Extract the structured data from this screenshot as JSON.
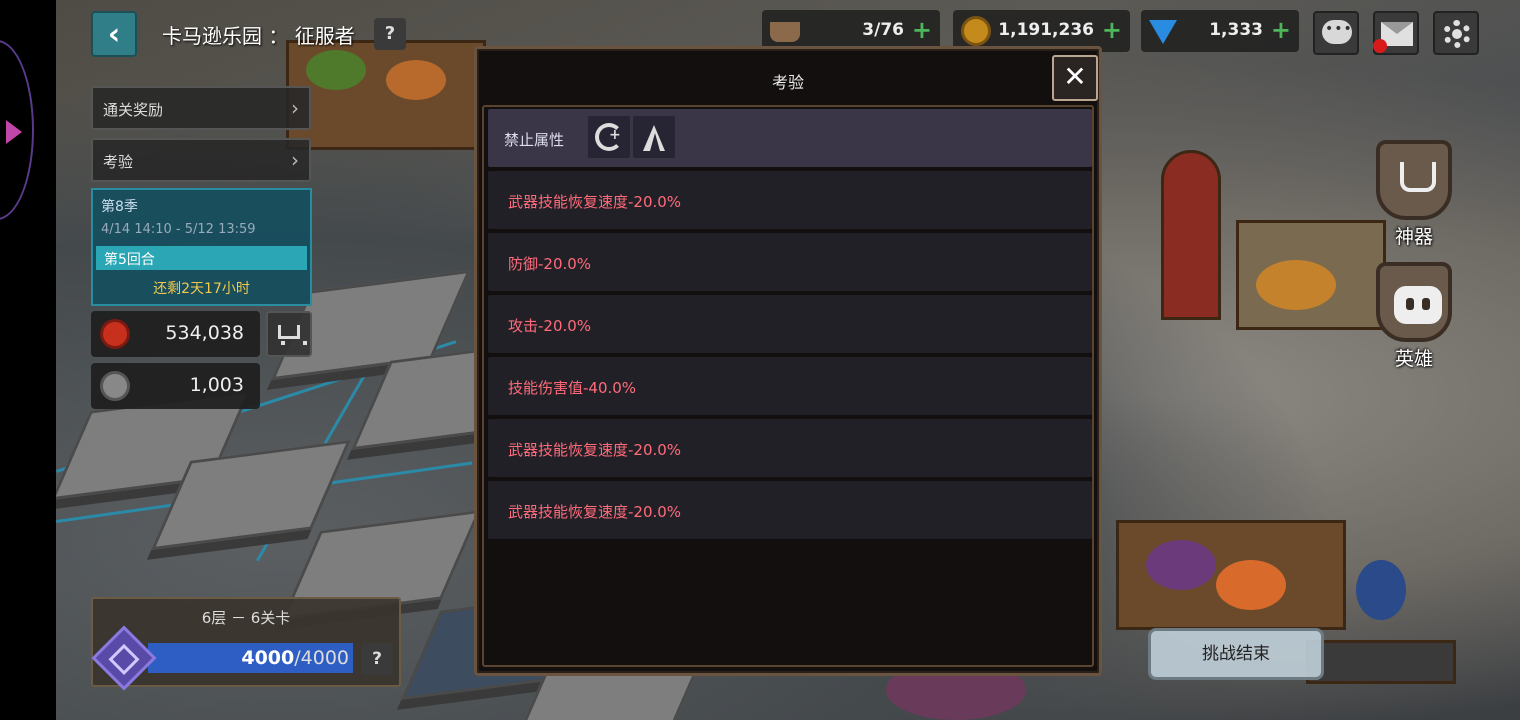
{
  "header": {
    "stage_title": "卡马逊乐园 ： 征服者",
    "help_label": "?"
  },
  "resources": [
    {
      "name": "stamina",
      "value": "3/76",
      "icon": "coffee-cup-icon"
    },
    {
      "name": "gold",
      "value": "1,191,236",
      "icon": "gold-coin-icon"
    },
    {
      "name": "gems",
      "value": "1,333",
      "icon": "blue-gem-icon"
    }
  ],
  "left_panel": {
    "reward_label": "通关奖励",
    "trial_label": "考验",
    "season_label": "第8季",
    "season_dates": "4/14 14:10 - 5/12 13:59",
    "round_label": "第5回合",
    "remaining_label": "还剩2天17小时",
    "currency_1": "534,038",
    "currency_2": "1,003"
  },
  "floor": {
    "label": "6层 － 6关卡",
    "progress_current": "4000",
    "progress_max": "4000",
    "progress_sep": "/",
    "progress_fraction": 1.0,
    "help_label": "?"
  },
  "side_buttons": {
    "artifact_label": "神器",
    "hero_label": "英雄"
  },
  "end_challenge_label": "挑战结束",
  "modal": {
    "title": "考验",
    "close_symbol": "✕",
    "banned_label": "禁止属性",
    "banned_attributes": [
      "moon-attribute-icon",
      "peak-attribute-icon"
    ],
    "modifiers": [
      "武器技能恢复速度-20.0%",
      "防御-20.0%",
      "攻击-20.0%",
      "技能伤害值-40.0%",
      "武器技能恢复速度-20.0%",
      "武器技能恢复速度-20.0%"
    ]
  },
  "colors": {
    "modifier_text": "#ff6b7a",
    "accent_teal": "#2f7e88",
    "progress_fill": "#2e5ec4",
    "remaining_text": "#f2c94c"
  }
}
